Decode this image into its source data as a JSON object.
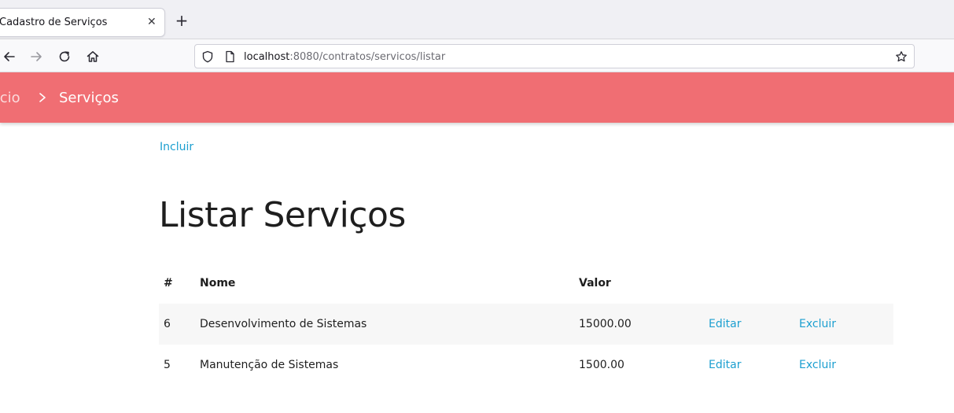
{
  "browser": {
    "tab_title": "Cadastro de Serviços",
    "tab_close_icon": "close-icon",
    "new_tab_icon": "plus-icon",
    "url_host": "localhost",
    "url_rest": ":8080/contratos/servicos/listar"
  },
  "header": {
    "home_label": "Início",
    "current_label": "Serviços",
    "accent_color": "#f06e73"
  },
  "main": {
    "include_label": "Incluir",
    "title": "Listar Serviços",
    "table": {
      "columns": [
        "#",
        "Nome",
        "Valor"
      ],
      "rows": [
        {
          "id": "6",
          "name": "Desenvolvimento de Sistemas",
          "value": "15000.00",
          "edit": "Editar",
          "delete": "Excluir"
        },
        {
          "id": "5",
          "name": "Manutenção de Sistemas",
          "value": "1500.00",
          "edit": "Editar",
          "delete": "Excluir"
        }
      ]
    }
  },
  "link_color": "#1c9fd0"
}
